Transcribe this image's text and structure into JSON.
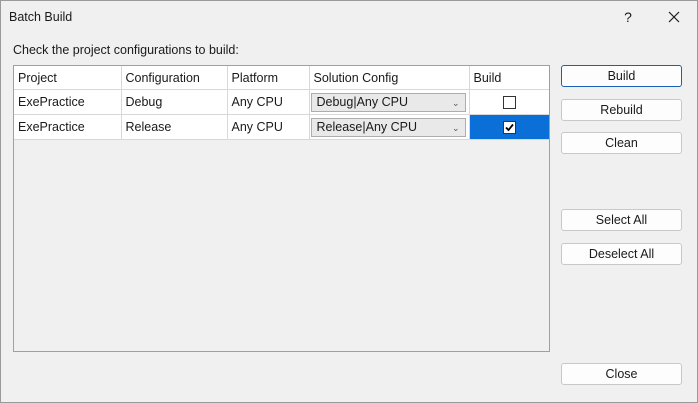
{
  "window": {
    "title": "Batch Build",
    "help_label": "?"
  },
  "instruction": "Check the project configurations to build:",
  "table": {
    "columns": [
      "Project",
      "Configuration",
      "Platform",
      "Solution Config",
      "Build"
    ],
    "rows": [
      {
        "project": "ExePractice",
        "configuration": "Debug",
        "platform": "Any CPU",
        "solution_config": "Debug|Any CPU",
        "build": false
      },
      {
        "project": "ExePractice",
        "configuration": "Release",
        "platform": "Any CPU",
        "solution_config": "Release|Any CPU",
        "build": true
      }
    ]
  },
  "buttons": {
    "build": "Build",
    "rebuild": "Rebuild",
    "clean": "Clean",
    "select_all": "Select All",
    "deselect_all": "Deselect All",
    "close": "Close"
  },
  "colors": {
    "selection": "#0a6fd6",
    "default_button_border": "#1a5fb4"
  }
}
